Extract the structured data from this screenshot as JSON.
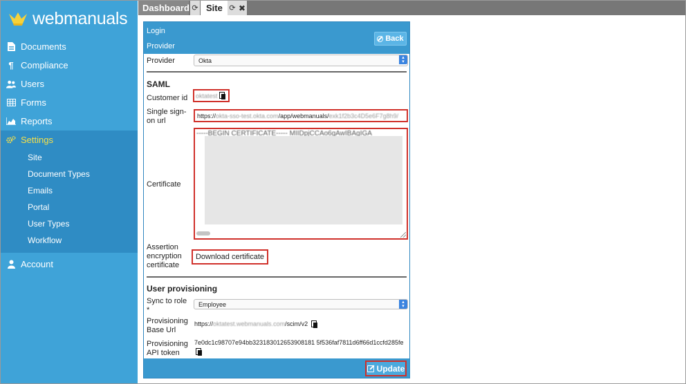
{
  "app": {
    "logo_text": "webmanuals"
  },
  "sidebar": {
    "items": [
      {
        "label": "Documents"
      },
      {
        "label": "Compliance"
      },
      {
        "label": "Users"
      },
      {
        "label": "Forms"
      },
      {
        "label": "Reports"
      },
      {
        "label": "Settings"
      }
    ],
    "settings_sub": [
      {
        "label": "Site"
      },
      {
        "label": "Document Types"
      },
      {
        "label": "Emails"
      },
      {
        "label": "Portal"
      },
      {
        "label": "User Types"
      },
      {
        "label": "Workflow"
      }
    ],
    "account": {
      "label": "Account"
    },
    "accent_color": "#f6e04a"
  },
  "tabs": [
    {
      "label": "Dashboard"
    },
    {
      "label": "Site"
    }
  ],
  "panel": {
    "header_title_1": "Login",
    "header_title_2": "Provider",
    "back_label": "Back",
    "provider_label": "Provider",
    "provider_value": "Okta",
    "saml_title": "SAML",
    "customer_id_label": "Customer id",
    "customer_id_value": "oktatest",
    "sso_label": "Single sign-on url",
    "sso_value_prefix": "https://",
    "sso_value_blurred": "okta-sso-test.okta.com",
    "sso_value_mid": "/app/webmanuals/",
    "sso_value_tail": "exk1f2b3c4D5e6F7g8h9/",
    "certificate_label": "Certificate",
    "certificate_value": "-----BEGIN CERTIFICATE----- MIIDpjCCAo6gAwIBAgIGA",
    "assertion_label": "Assertion encryption certificate",
    "download_label": "Download certificate",
    "provisioning_title": "User provisioning",
    "sync_label": "Sync to role *",
    "sync_value": "Employee",
    "base_url_label": "Provisioning Base Url",
    "base_url_prefix": "https://",
    "base_url_blurred": "oktatest.webmanuals.com",
    "base_url_suffix": "/scim/v2",
    "api_token_label": "Provisioning API token",
    "api_token_value": "7e0dc1c98707e94bb323183012653908181 5f536faf7811d6ff66d1ccfd285fe",
    "update_label": "Update"
  }
}
